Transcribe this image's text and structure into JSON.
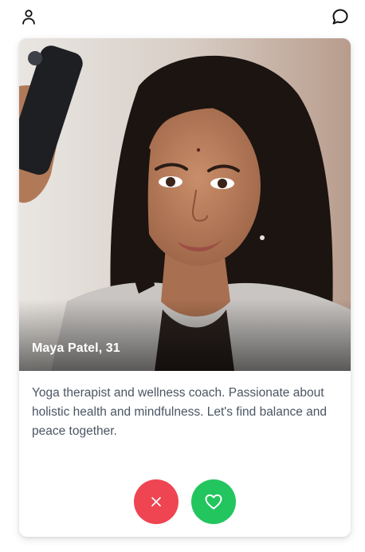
{
  "topbar": {
    "left_icon": "user-icon",
    "right_icon": "chat-bubble-icon"
  },
  "profile": {
    "name_age": "Maya Patel, 31",
    "bio": "Yoga therapist and wellness coach. Passionate about holistic health and mindfulness. Let's find balance and peace together."
  },
  "actions": {
    "pass_icon": "close-icon",
    "like_icon": "heart-icon",
    "pass_color": "#ef4452",
    "like_color": "#22c55e"
  }
}
